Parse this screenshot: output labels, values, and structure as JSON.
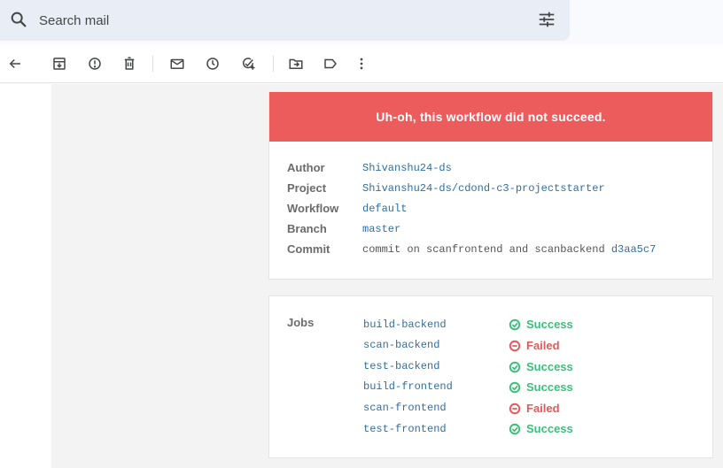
{
  "search": {
    "placeholder": "Search mail"
  },
  "icons": {
    "search": "search-icon",
    "tune": "tune-icon",
    "back": "arrow-back-icon",
    "archive": "archive-icon",
    "spam": "report-spam-icon",
    "delete": "delete-icon",
    "unread": "mark-unread-icon",
    "snooze": "snooze-icon",
    "task": "add-task-icon",
    "move": "move-to-icon",
    "label": "label-icon",
    "more": "more-vert-icon"
  },
  "email": {
    "banner": "Uh-oh, this workflow did not succeed.",
    "details": {
      "author_label": "Author",
      "author": "Shivanshu24-ds",
      "project_label": "Project",
      "project": "Shivanshu24-ds/cdond-c3-projectstarter",
      "workflow_label": "Workflow",
      "workflow": "default",
      "branch_label": "Branch",
      "branch": "master",
      "commit_label": "Commit",
      "commit_message": "commit on scanfrontend and scanbackend",
      "commit_sha": "d3aa5c7"
    },
    "jobs_label": "Jobs",
    "jobs": [
      {
        "name": "build-backend",
        "status": "Success"
      },
      {
        "name": "scan-backend",
        "status": "Failed"
      },
      {
        "name": "test-backend",
        "status": "Success"
      },
      {
        "name": "build-frontend",
        "status": "Success"
      },
      {
        "name": "scan-frontend",
        "status": "Failed"
      },
      {
        "name": "test-frontend",
        "status": "Success"
      }
    ]
  },
  "colors": {
    "banner": "#ed5c5c",
    "success": "#3bbf78",
    "failed": "#e65858",
    "link": "#2f6fa3"
  }
}
